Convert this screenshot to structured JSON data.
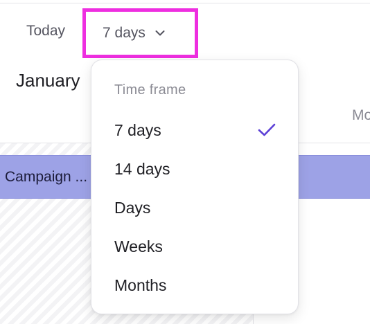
{
  "toolbar": {
    "today_label": "Today",
    "range_selected": "7 days",
    "chevron_icon": "chevron-down-icon",
    "highlight_color": "#ee2ee0"
  },
  "calendar": {
    "month_label": "January",
    "day_header_partial": "Mo",
    "campaign_label": "Campaign ...",
    "campaign_color": "#9da2e6"
  },
  "dropdown": {
    "heading": "Time frame",
    "items": [
      {
        "label": "7 days",
        "selected": true
      },
      {
        "label": "14 days",
        "selected": false
      },
      {
        "label": "Days",
        "selected": false
      },
      {
        "label": "Weeks",
        "selected": false
      },
      {
        "label": "Months",
        "selected": false
      }
    ],
    "check_icon": "checkmark-icon",
    "accent_color": "#5b3fd6"
  }
}
